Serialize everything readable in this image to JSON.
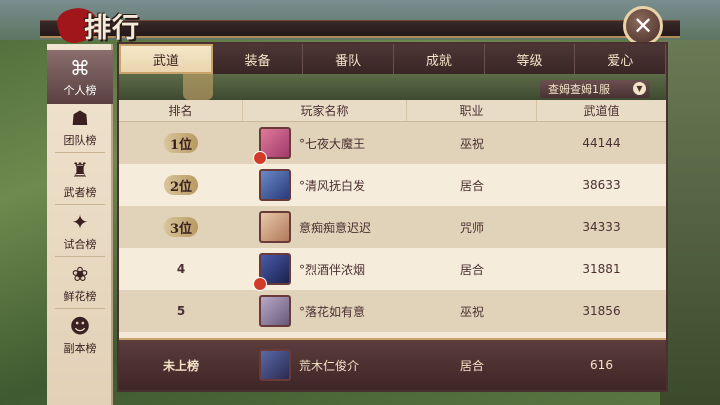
{
  "header": {
    "title": "排行榜",
    "close_icon": "close-icon"
  },
  "sidebar": {
    "items": [
      {
        "label": "个人榜",
        "icon": "fan-icon",
        "active": true
      },
      {
        "label": "团队榜",
        "icon": "demon-mask-icon",
        "active": false
      },
      {
        "label": "武者榜",
        "icon": "helmet-icon",
        "active": false
      },
      {
        "label": "试合榜",
        "icon": "shuriken-icon",
        "active": false
      },
      {
        "label": "鲜花榜",
        "icon": "flower-icon",
        "active": false
      },
      {
        "label": "副本榜",
        "icon": "oni-mask-icon",
        "active": false
      }
    ]
  },
  "tabs": [
    "武道",
    "装备",
    "番队",
    "成就",
    "等级",
    "爱心"
  ],
  "server_select": {
    "label": "查姆查姆1服"
  },
  "table": {
    "headers": [
      "排名",
      "玩家名称",
      "职业",
      "武道值"
    ],
    "rows": [
      {
        "rank": "1位",
        "name": "°七夜大魔王",
        "job": "巫祝",
        "score": "44144"
      },
      {
        "rank": "2位",
        "name": "°清风抚白发",
        "job": "居合",
        "score": "38633"
      },
      {
        "rank": "3位",
        "name": "意痴痴意迟迟",
        "job": "咒师",
        "score": "34333"
      },
      {
        "rank": "4",
        "name": "°烈酒伴浓烟",
        "job": "居合",
        "score": "31881"
      },
      {
        "rank": "5",
        "name": "°落花如有意",
        "job": "巫祝",
        "score": "31856"
      }
    ]
  },
  "my_rank": {
    "rank": "未上榜",
    "name": "荒木仁俊介",
    "job": "居合",
    "score": "616"
  }
}
